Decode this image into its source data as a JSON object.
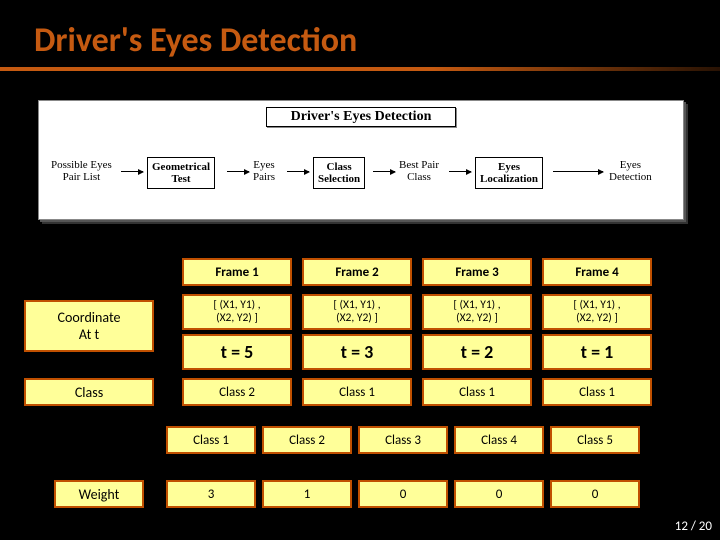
{
  "title": "Driver's Eyes Detection",
  "diagram": {
    "title": "Driver's Eyes Detection",
    "steps": [
      "Possible Eyes\nPair List",
      "Geometrical\nTest",
      "Eyes\nPairs",
      "Class\nSelection",
      "Best Pair\nClass",
      "Eyes\nLocalization",
      "Eyes\nDetection"
    ]
  },
  "side_labels": {
    "coord": "Coordinate\nAt t",
    "class": "Class",
    "weight": "Weight"
  },
  "frames": {
    "headers": [
      "Frame 1",
      "Frame 2",
      "Frame 3",
      "Frame 4"
    ],
    "coords": [
      "[ (X1, Y1) ,\n(X2, Y2) ]",
      "[ (X1, Y1) ,\n(X2, Y2) ]",
      "[ (X1, Y1) ,\n(X2, Y2) ]",
      "[ (X1, Y1) ,\n(X2, Y2) ]"
    ],
    "t": [
      "t = 5",
      "t = 3",
      "t = 2",
      "t = 1"
    ],
    "classes": [
      "Class 2",
      "Class 1",
      "Class 1",
      "Class 1"
    ]
  },
  "weights": {
    "classes": [
      "Class 1",
      "Class 2",
      "Class 3",
      "Class 4",
      "Class 5"
    ],
    "values": [
      "3",
      "1",
      "0",
      "0",
      "0"
    ]
  },
  "page": "12 / 20"
}
